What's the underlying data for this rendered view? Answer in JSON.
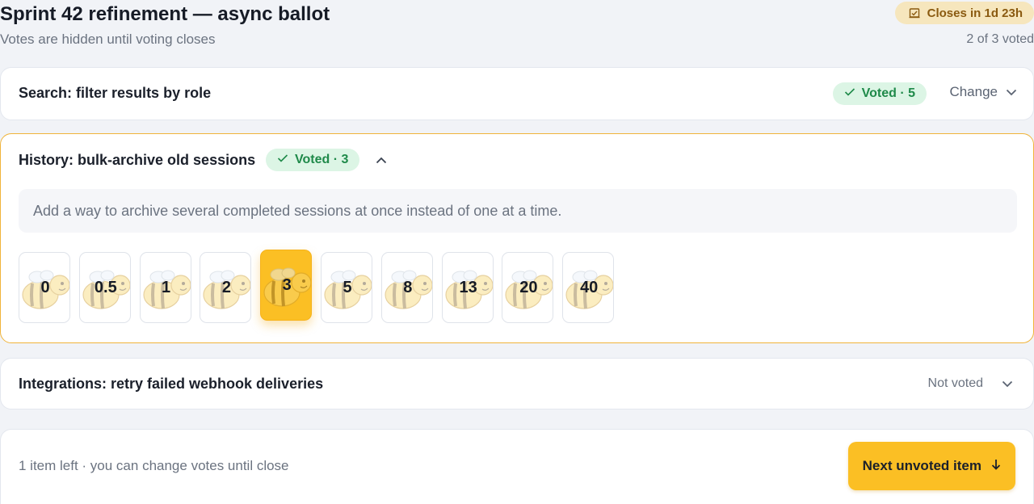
{
  "header": {
    "title": "Sprint 42 refinement — async ballot",
    "subtitle": "Votes are hidden until voting closes",
    "closes_label": "Closes in 1d 23h",
    "closes_icon": "ballot-box-icon",
    "voted_count": "2 of 3 voted"
  },
  "items": [
    {
      "title": "Search: filter results by role",
      "badge": "Voted · 5",
      "action_label": "Change",
      "state": "collapsed"
    },
    {
      "title": "History: bulk-archive old sessions",
      "badge": "Voted · 3",
      "state": "expanded",
      "description": "Add a way to archive several completed sessions at once instead of one at a time.",
      "estimates": [
        "0",
        "0.5",
        "1",
        "2",
        "3",
        "5",
        "8",
        "13",
        "20",
        "40"
      ],
      "selected_estimate": "3"
    },
    {
      "title": "Integrations: retry failed webhook deliveries",
      "status": "Not voted",
      "state": "collapsed"
    }
  ],
  "footer": {
    "text": "1 item left · you can change votes until close",
    "next_label": "Next unvoted item"
  },
  "colors": {
    "accent": "#fbbf24",
    "accent_border": "#f0b43a",
    "voted_bg": "#dcf5e5",
    "voted_text": "#1f8a4a",
    "closes_bg": "#f6e6bd",
    "closes_text": "#8a5a10"
  }
}
